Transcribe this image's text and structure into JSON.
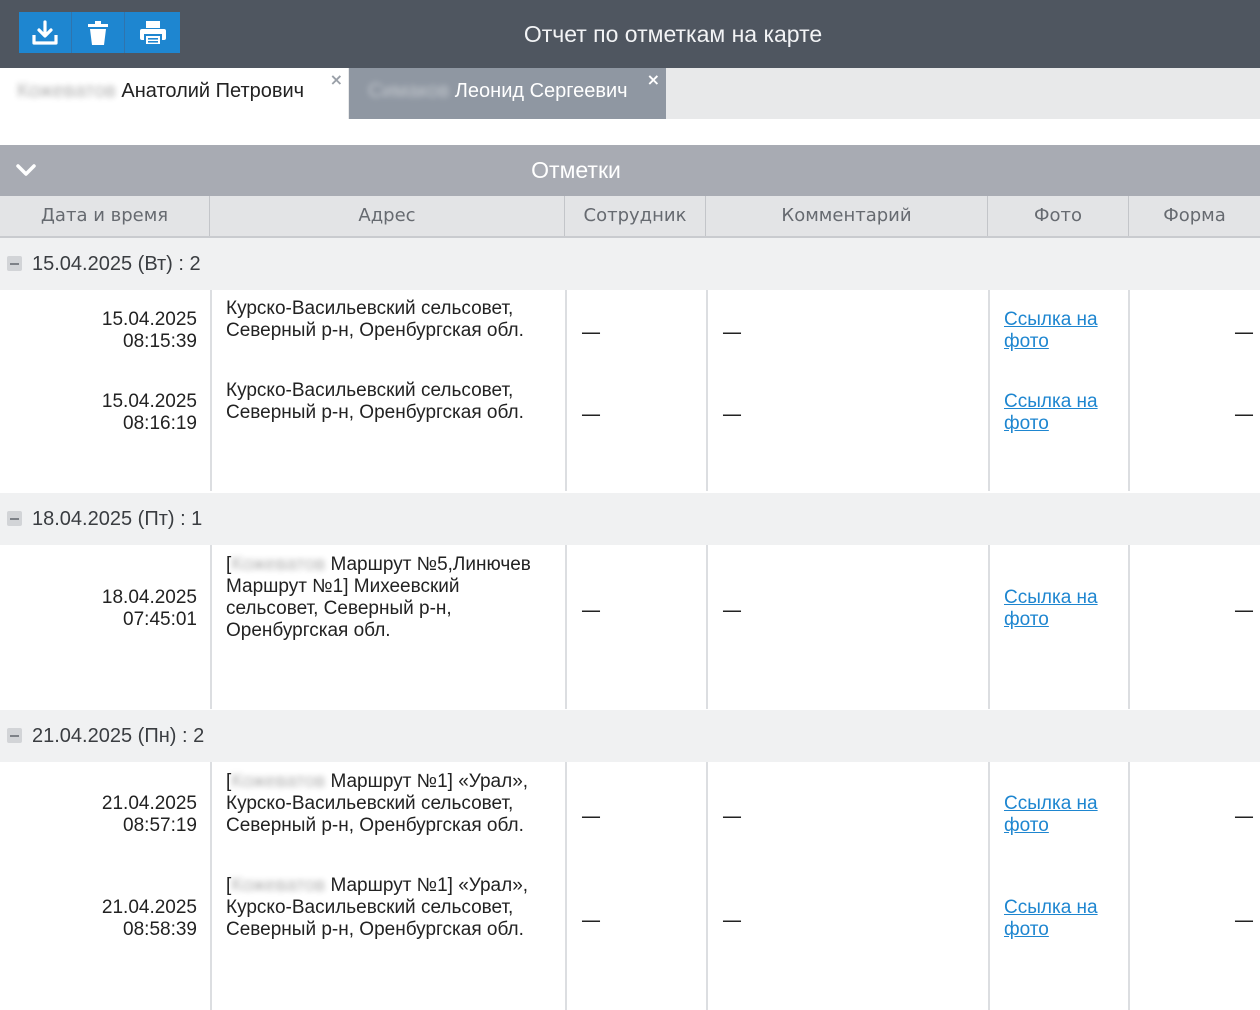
{
  "toolbar": {
    "buttons": [
      {
        "icon": "download-icon"
      },
      {
        "icon": "trash-icon"
      },
      {
        "icon": "printer-icon"
      }
    ]
  },
  "header": {
    "title": "Отчет по отметкам на карте"
  },
  "tabs": [
    {
      "name_blurred": "Кожеватов",
      "name": "Анатолий Петрович",
      "close": "×",
      "active": true
    },
    {
      "name_blurred": "Симаков",
      "name": "Леонид Сергеевич",
      "close": "×",
      "active": false
    }
  ],
  "section": {
    "title": "Отметки"
  },
  "columns": [
    "Дата и время",
    "Адрес",
    "Сотрудник",
    "Комментарий",
    "Фото",
    "Форма"
  ],
  "groups": [
    {
      "label": "15.04.2025 (Вт) : 2",
      "rows": [
        {
          "date": "15.04.2025",
          "time": "08:15:39",
          "address": "Курско-Васильевский сельсовет, Северный р-н, Оренбургская обл.",
          "employee": "—",
          "comment": "—",
          "photo": "Ссылка на фото",
          "form": "—"
        },
        {
          "date": "15.04.2025",
          "time": "08:16:19",
          "address": "Курско-Васильевский сельсовет, Северный р-н, Оренбургская обл.",
          "employee": "—",
          "comment": "—",
          "photo": "Ссылка на фото",
          "form": "—"
        }
      ]
    },
    {
      "label": "18.04.2025 (Пт) : 1",
      "rows": [
        {
          "date": "18.04.2025",
          "time": "07:45:01",
          "address_prefix": "[",
          "address_blurred": "Кожеватов",
          "address": " Маршрут №5,Линючев Маршрут №1] Михеевский сельсовет, Северный р-н, Оренбургская обл.",
          "employee": "—",
          "comment": "—",
          "photo": "Ссылка на фото",
          "form": "—"
        }
      ]
    },
    {
      "label": "21.04.2025 (Пн) : 2",
      "rows": [
        {
          "date": "21.04.2025",
          "time": "08:57:19",
          "address_prefix": "[",
          "address_blurred": "Кожеватов",
          "address": " Маршрут №1] «Урал», Курско-Васильевский сельсовет, Северный р-н, Оренбургская обл.",
          "employee": "—",
          "comment": "—",
          "photo": "Ссылка на фото",
          "form": "—"
        },
        {
          "date": "21.04.2025",
          "time": "08:58:39",
          "address_prefix": "[",
          "address_blurred": "Кожеватов",
          "address": " Маршрут №1] «Урал», Курско-Васильевский сельсовет, Северный р-н, Оренбургская обл.",
          "employee": "—",
          "comment": "—",
          "photo": "Ссылка на фото",
          "form": "—"
        }
      ]
    }
  ],
  "colors": {
    "topbar": "#4f5660",
    "accent": "#1e86d0",
    "section_header": "#a8abb3",
    "inactive_tab": "#8f97a2",
    "group_row": "#f0f1f2"
  }
}
